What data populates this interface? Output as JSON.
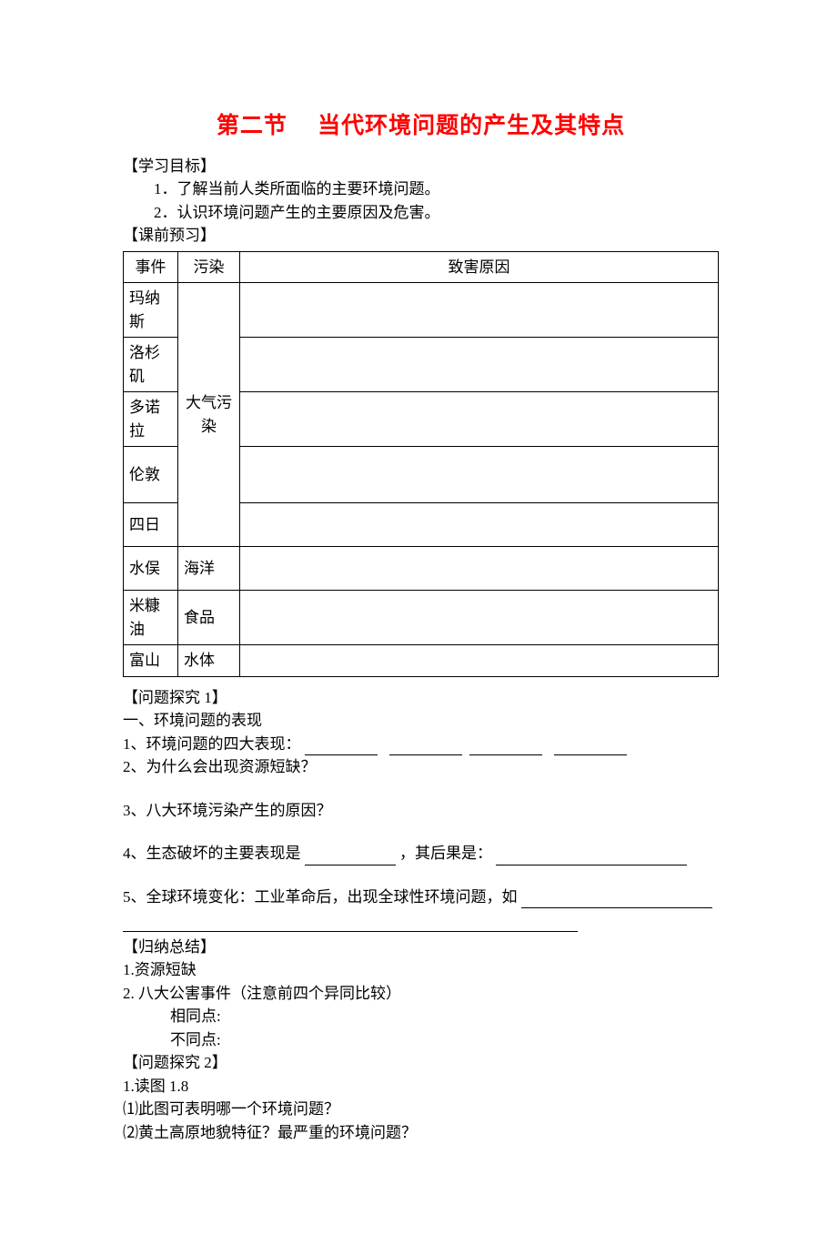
{
  "title": "第二节　 当代环境问题的产生及其特点",
  "labels": {
    "learning_goal": "【学习目标】",
    "preview": "【课前预习】",
    "inquiry1": "【问题探究 1】",
    "summary": "【归纳总结】",
    "inquiry2": "【问题探究 2】"
  },
  "goals": [
    "1．了解当前人类所面临的主要环境问题。",
    "2．认识环境问题产生的主要原因及危害。"
  ],
  "table": {
    "headers": {
      "event": "事件",
      "pollution": "污染",
      "cause": "致害原因"
    },
    "rows": [
      {
        "event": "玛纳斯",
        "pollution": "",
        "cause": ""
      },
      {
        "event": "洛杉矶",
        "pollution": "",
        "cause": ""
      },
      {
        "event": "多诺拉",
        "pollution": "",
        "cause": ""
      },
      {
        "event": "伦敦",
        "pollution": "",
        "cause": ""
      },
      {
        "event": "四日",
        "pollution": "",
        "cause": ""
      },
      {
        "event": "水俣",
        "pollution": "海洋",
        "cause": ""
      },
      {
        "event": "米糠油",
        "pollution": "食品",
        "cause": ""
      },
      {
        "event": "富山",
        "pollution": "水体",
        "cause": ""
      }
    ],
    "merged_pollution": "大气污染"
  },
  "inquiry1": {
    "heading": "一、环境问题的表现",
    "q1_prefix": "1、环境问题的四大表现：",
    "q2": "2、为什么会出现资源短缺？",
    "q3": "3、八大环境污染产生的原因？",
    "q4_pre": "4、生态破坏的主要表现是",
    "q4_mid": "，其后果是：",
    "q5_pre": "5、全球环境变化：工业革命后，出现全球性环境问题，如"
  },
  "summary": {
    "s1": "1.资源短缺",
    "s2": "2. 八大公害事件（注意前四个异同比较）",
    "s2a": "相同点:",
    "s2b": "不同点:"
  },
  "inquiry2": {
    "q1": "1.读图 1.8",
    "q1a": "⑴此图可表明哪一个环境问题？",
    "q1b": "⑵黄土高原地貌特征？最严重的环境问题？"
  }
}
